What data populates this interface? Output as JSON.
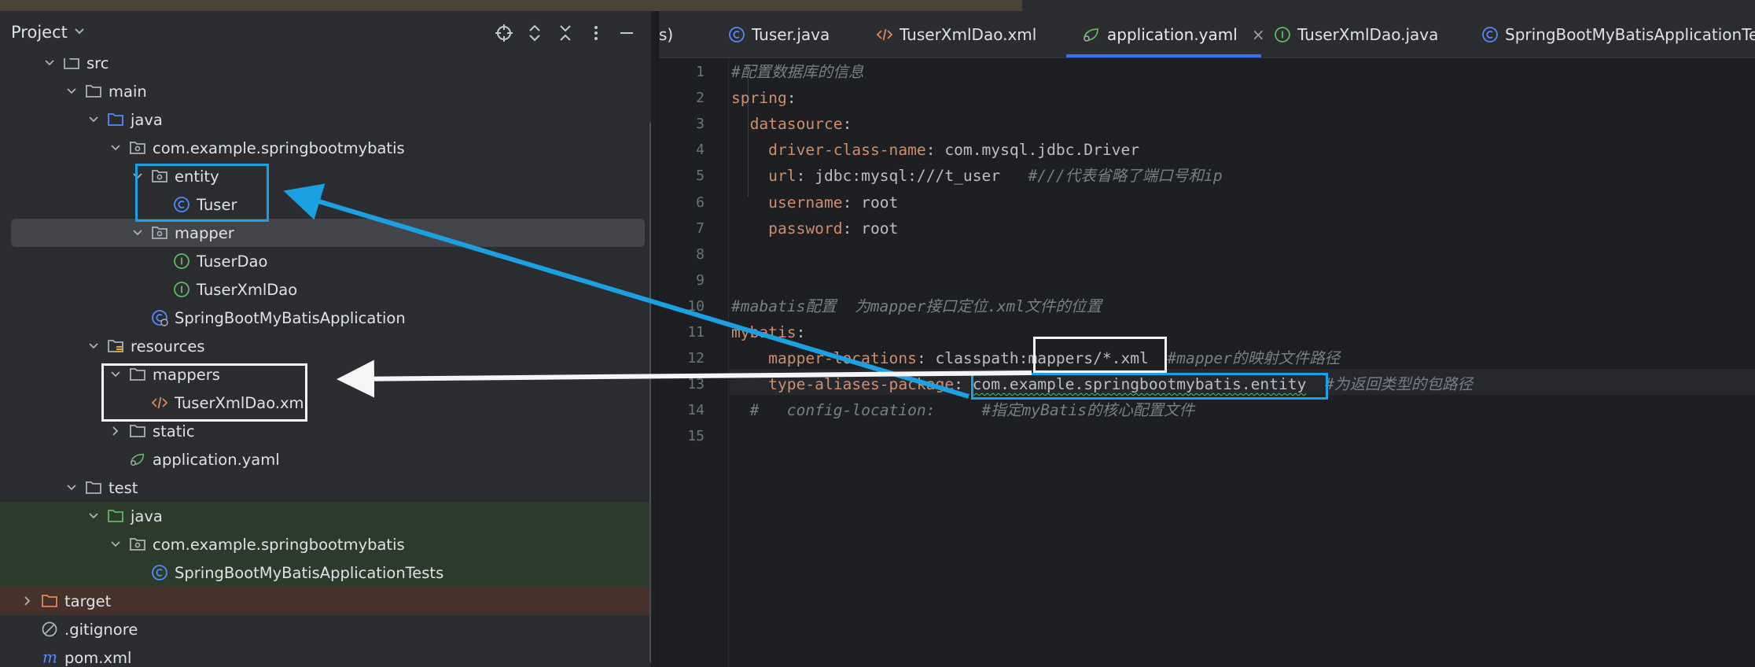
{
  "panel": {
    "title": "Project",
    "header_icons": [
      "crosshair-icon",
      "expand-collapse-icon",
      "collapse-all-icon",
      "more-vert-icon",
      "minimize-icon"
    ]
  },
  "tree": [
    {
      "label": "src",
      "icon": "folder-icon",
      "kind": "folder",
      "expanded": true
    },
    {
      "label": "main",
      "icon": "folder-icon",
      "kind": "folder",
      "expanded": true
    },
    {
      "label": "java",
      "icon": "source-folder-icon",
      "kind": "source",
      "expanded": true
    },
    {
      "label": "com.example.springbootmybatis",
      "icon": "package-icon",
      "kind": "package",
      "expanded": true
    },
    {
      "label": "entity",
      "icon": "package-icon",
      "kind": "package",
      "expanded": true
    },
    {
      "label": "Tuser",
      "icon": "class-icon",
      "kind": "class",
      "expanded": null
    },
    {
      "label": "mapper",
      "icon": "package-icon",
      "kind": "package",
      "expanded": true
    },
    {
      "label": "TuserDao",
      "icon": "interface-icon",
      "kind": "interface",
      "expanded": null
    },
    {
      "label": "TuserXmlDao",
      "icon": "interface-icon",
      "kind": "interface",
      "expanded": null
    },
    {
      "label": "SpringBootMyBatisApplication",
      "icon": "spring-class-icon",
      "kind": "springclass",
      "expanded": null
    },
    {
      "label": "resources",
      "icon": "resources-folder-icon",
      "kind": "resources",
      "expanded": true
    },
    {
      "label": "mappers",
      "icon": "folder-icon",
      "kind": "folder",
      "expanded": true
    },
    {
      "label": "TuserXmlDao.xml",
      "icon": "xml-file-icon",
      "kind": "xml",
      "expanded": null
    },
    {
      "label": "static",
      "icon": "folder-icon",
      "kind": "folder",
      "expanded": false
    },
    {
      "label": "application.yaml",
      "icon": "yaml-spring-icon",
      "kind": "yaml",
      "expanded": null
    },
    {
      "label": "test",
      "icon": "folder-icon",
      "kind": "folder",
      "expanded": true
    },
    {
      "label": "java",
      "icon": "test-source-folder-icon",
      "kind": "testsource",
      "expanded": true
    },
    {
      "label": "com.example.springbootmybatis",
      "icon": "package-icon",
      "kind": "package",
      "expanded": true
    },
    {
      "label": "SpringBootMyBatisApplicationTests",
      "icon": "class-icon",
      "kind": "class",
      "expanded": null
    },
    {
      "label": "target",
      "icon": "excluded-folder-icon",
      "kind": "excluded",
      "expanded": false
    },
    {
      "label": ".gitignore",
      "icon": "ignore-file-icon",
      "kind": "ignore",
      "expanded": null
    },
    {
      "label": "pom.xml",
      "icon": "maven-icon",
      "kind": "maven",
      "expanded": null
    }
  ],
  "selected_item": "mapper",
  "tabs": [
    {
      "label": "s)",
      "icon": null,
      "active": false
    },
    {
      "label": "Tuser.java",
      "icon": "class-icon",
      "active": false
    },
    {
      "label": "TuserXmlDao.xml",
      "icon": "xml-file-icon",
      "active": false
    },
    {
      "label": "application.yaml",
      "icon": "yaml-spring-icon",
      "active": true,
      "close": "×"
    },
    {
      "label": "TuserXmlDao.java",
      "icon": "interface-icon",
      "active": false
    },
    {
      "label": "SpringBootMyBatisApplicationTests",
      "icon": "class-icon",
      "active": false
    }
  ],
  "code": {
    "line_numbers": [
      "1",
      "2",
      "3",
      "4",
      "5",
      "6",
      "7",
      "8",
      "9",
      "10",
      "11",
      "12",
      "13",
      "14",
      "15"
    ],
    "lines": [
      {
        "n": 1,
        "spans": [
          {
            "t": "#配置数据库的信息",
            "c": "cm"
          }
        ]
      },
      {
        "n": 2,
        "spans": [
          {
            "t": "spring",
            "c": "key"
          },
          {
            "t": ":",
            "c": "val"
          }
        ]
      },
      {
        "n": 3,
        "spans": [
          {
            "t": "  datasource",
            "c": "key"
          },
          {
            "t": ":",
            "c": "val"
          }
        ]
      },
      {
        "n": 4,
        "spans": [
          {
            "t": "    driver-class-name",
            "c": "key"
          },
          {
            "t": ": com.mysql.jdbc.Driver",
            "c": "val"
          }
        ]
      },
      {
        "n": 5,
        "spans": [
          {
            "t": "    url",
            "c": "key"
          },
          {
            "t": ": jdbc:mysql:///t_user   ",
            "c": "val"
          },
          {
            "t": "#///代表省略了端口号和ip",
            "c": "cm"
          }
        ]
      },
      {
        "n": 6,
        "spans": [
          {
            "t": "    username",
            "c": "key"
          },
          {
            "t": ": root",
            "c": "val"
          }
        ]
      },
      {
        "n": 7,
        "spans": [
          {
            "t": "    password",
            "c": "key"
          },
          {
            "t": ": root",
            "c": "val"
          }
        ]
      },
      {
        "n": 8,
        "spans": []
      },
      {
        "n": 9,
        "spans": []
      },
      {
        "n": 10,
        "spans": [
          {
            "t": "#mabatis配置  为mapper接口定位.xml文件的位置",
            "c": "cm"
          }
        ]
      },
      {
        "n": 11,
        "spans": [
          {
            "t": "mybatis",
            "c": "key"
          },
          {
            "t": ":",
            "c": "val"
          }
        ]
      },
      {
        "n": 12,
        "spans": [
          {
            "t": "    mapper-locations",
            "c": "key"
          },
          {
            "t": ": classpath:mappers/*.xml  ",
            "c": "val"
          },
          {
            "t": "#mapper的映射文件路径",
            "c": "cm"
          }
        ]
      },
      {
        "n": 13,
        "spans": [
          {
            "t": "    type-aliases-package",
            "c": "key"
          },
          {
            "t": ": ",
            "c": "val"
          },
          {
            "t": "com.example.springbootmybatis.entity",
            "c": "val"
          },
          {
            "t": "  #为返回类型的包路径",
            "c": "cm"
          }
        ]
      },
      {
        "n": 14,
        "spans": [
          {
            "t": "  #   config-location:     #指定myBatis的核心配置文件",
            "c": "cm"
          }
        ]
      },
      {
        "n": 15,
        "spans": []
      }
    ]
  },
  "colors": {
    "annotation_blue": "#1ba1e2",
    "annotation_white": "#f5f5f5",
    "yaml_key": "#cf8e6d",
    "comment": "#7a7e85",
    "selection": "#43454a",
    "tab_underline": "#3574f0"
  }
}
